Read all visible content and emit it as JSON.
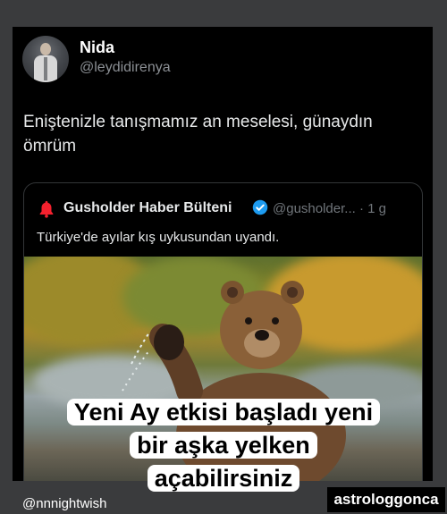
{
  "tweet": {
    "author_name": "Nida",
    "author_handle": "@leydidirenya",
    "text": "Eniştenizle tanışmamız an meselesi, günaydın ömrüm"
  },
  "quoted_tweet": {
    "account_name": "Gusholder Haber Bülteni",
    "handle_time": "@gusholder... · 1 g",
    "text": "Türkiye'de ayılar kış uykusundan uyandı.",
    "icon": "bell-icon",
    "verified_icon": "verified-badge-icon"
  },
  "caption": {
    "line1": "Yeni Ay etkisi başladı yeni",
    "line2": "bir aşka yelken",
    "line3": "açabilirsiniz"
  },
  "footer": {
    "left_handle": "@nnnightwish",
    "right_tag": "astrologgonca"
  },
  "colors": {
    "background": "#3a3b3d",
    "card": "#000000",
    "verified": "#1d9bf0",
    "bell": "#f4212e"
  }
}
